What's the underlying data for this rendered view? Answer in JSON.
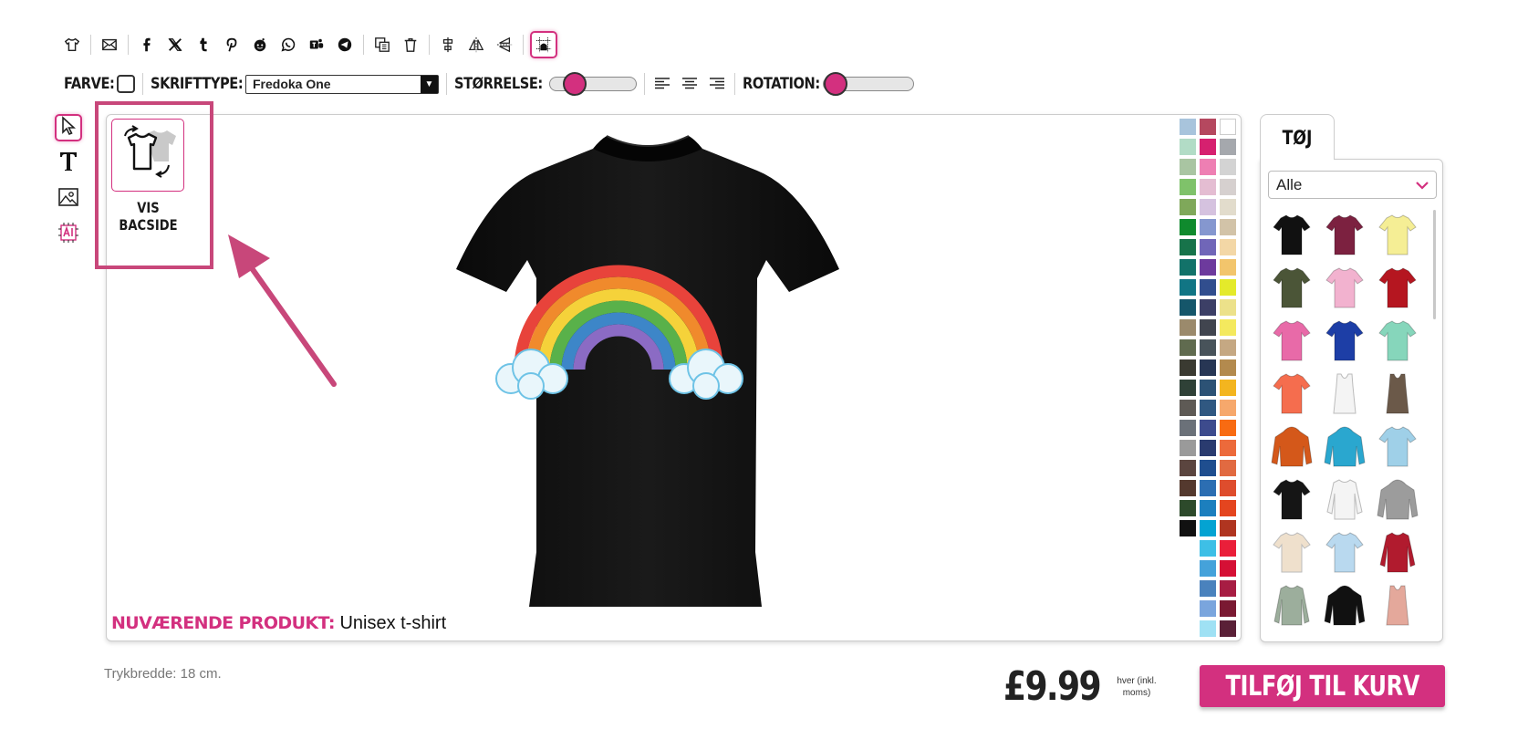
{
  "toolbar": {
    "buttons": [
      "shirt-icon",
      "mail-icon",
      "facebook-icon",
      "x-icon",
      "tumblr-icon",
      "pinterest-icon",
      "reddit-icon",
      "whatsapp-icon",
      "teams-icon",
      "telegram-icon",
      "copy-icon",
      "trash-icon",
      "align-center-icon",
      "flip-horizontal-icon",
      "flip-vertical-icon",
      "grid-icon"
    ]
  },
  "options": {
    "color_label": "FARVE:",
    "font_label": "SKRIFTTYPE:",
    "font_value": "Fredoka One",
    "size_label": "STØRRELSE:",
    "size_value": 0.25,
    "rotation_label": "ROTATION:",
    "rotation_value": 0.05
  },
  "left_tools": [
    "select-icon",
    "text-icon",
    "image-icon",
    "ai-icon"
  ],
  "back_side": {
    "label": "VIS BACSIDE"
  },
  "canvas": {
    "current_product_label": "NUVÆRENDE PRODUKT:",
    "current_product_value": "Unisex t-shirt"
  },
  "colors": {
    "swatches": [
      "#a8c4dc",
      "#b5485f",
      "#ffffff",
      "#b2dcc6",
      "#d6206f",
      "#a5a8ad",
      "#a9c5a2",
      "#ee7fb3",
      "#d3d3d3",
      "#7fc26a",
      "#e4bdd2",
      "#d6d0cf",
      "#7fa85a",
      "#d5c2df",
      "#e2dccc",
      "#0f8a2d",
      "#8597cf",
      "#d2c3a8",
      "#17734a",
      "#7066b8",
      "#f3d7a6",
      "#127269",
      "#6d3a9d",
      "#f2c56c",
      "#117584",
      "#314e8e",
      "#e4ea2a",
      "#15566a",
      "#3c3f66",
      "#ece18a",
      "#9b8a6c",
      "#41454f",
      "#f4e95e",
      "#606b4f",
      "#48535a",
      "#c5a883",
      "#3a3a31",
      "#273654",
      "#b38a4e",
      "#2f4137",
      "#2c5275",
      "#f3b51f",
      "#5e5a55",
      "#305881",
      "#f6a86c",
      "#6b7179",
      "#3d4b8d",
      "#f86b12",
      "#9a9a9a",
      "#2a3b6f",
      "#ec6a3b",
      "#5b453f",
      "#1f4e8f",
      "#e16a41",
      "#54392e",
      "#2c6eb2",
      "#de4d2d",
      "#2d4a2b",
      "#1c7fbe",
      "#e4451f",
      "#111111",
      "#04a3d2",
      "#b03520",
      "",
      "#3ebfe6",
      "#ea1f3a",
      "",
      "#45a2da",
      "#d51035",
      "",
      "#4a82bd",
      "#a71d43",
      "",
      "#7aa5dd",
      "#7a1932",
      "",
      "#9fe1f4",
      "#5a2037"
    ]
  },
  "panel": {
    "tab_label": "TØJ",
    "filter_value": "Alle",
    "products": [
      {
        "name": "black-tshirt",
        "color": "#111111",
        "kind": "tee"
      },
      {
        "name": "maroon-tshirt",
        "color": "#7c2140",
        "kind": "tee"
      },
      {
        "name": "yellow-tshirt",
        "color": "#f5ee95",
        "kind": "tee"
      },
      {
        "name": "olive-tshirt",
        "color": "#4b5537",
        "kind": "tee"
      },
      {
        "name": "pink-tshirt",
        "color": "#f2b2cf",
        "kind": "tee"
      },
      {
        "name": "red-tshirt",
        "color": "#b51620",
        "kind": "tee"
      },
      {
        "name": "pink-womens-tshirt",
        "color": "#e86aa8",
        "kind": "tee"
      },
      {
        "name": "royal-tshirt",
        "color": "#1d3ea6",
        "kind": "tee"
      },
      {
        "name": "mint-tshirt",
        "color": "#86d6bb",
        "kind": "tee"
      },
      {
        "name": "coral-tshirt",
        "color": "#f56d4e",
        "kind": "tee"
      },
      {
        "name": "white-tank",
        "color": "#f4f4f4",
        "kind": "tank"
      },
      {
        "name": "brown-tank",
        "color": "#6b5949",
        "kind": "tank"
      },
      {
        "name": "orange-hoodie",
        "color": "#d4581a",
        "kind": "hoodie"
      },
      {
        "name": "turquoise-hoodie",
        "color": "#2aa7cf",
        "kind": "hoodie"
      },
      {
        "name": "tie-dye-tshirt",
        "color": "#9fd0e8",
        "kind": "tee"
      },
      {
        "name": "black-tshirt-2",
        "color": "#151515",
        "kind": "tee"
      },
      {
        "name": "raglan-longsleeve",
        "color": "#f4f4f4",
        "kind": "raglan"
      },
      {
        "name": "grey-hoodie",
        "color": "#9c9c9c",
        "kind": "hoodie"
      },
      {
        "name": "natural-tshirt",
        "color": "#efe0cc",
        "kind": "tee"
      },
      {
        "name": "light-blue-tshirt",
        "color": "#b9d9ef",
        "kind": "tee"
      },
      {
        "name": "red-varsity-jacket",
        "color": "#b11b2e",
        "kind": "raglan"
      },
      {
        "name": "sage-longsleeve",
        "color": "#9cae9c",
        "kind": "longsleeve"
      },
      {
        "name": "black-orange-hoodie",
        "color": "#111111",
        "kind": "hoodie"
      },
      {
        "name": "salmon-tank",
        "color": "#e4a89b",
        "kind": "tank"
      }
    ]
  },
  "footer": {
    "print_width": "Trykbredde: 18 cm.",
    "price": "£9.99",
    "price_note": "hver (inkl. moms)",
    "cart_label": "TILFØJ TIL KURV"
  },
  "accent": "#d3307f"
}
